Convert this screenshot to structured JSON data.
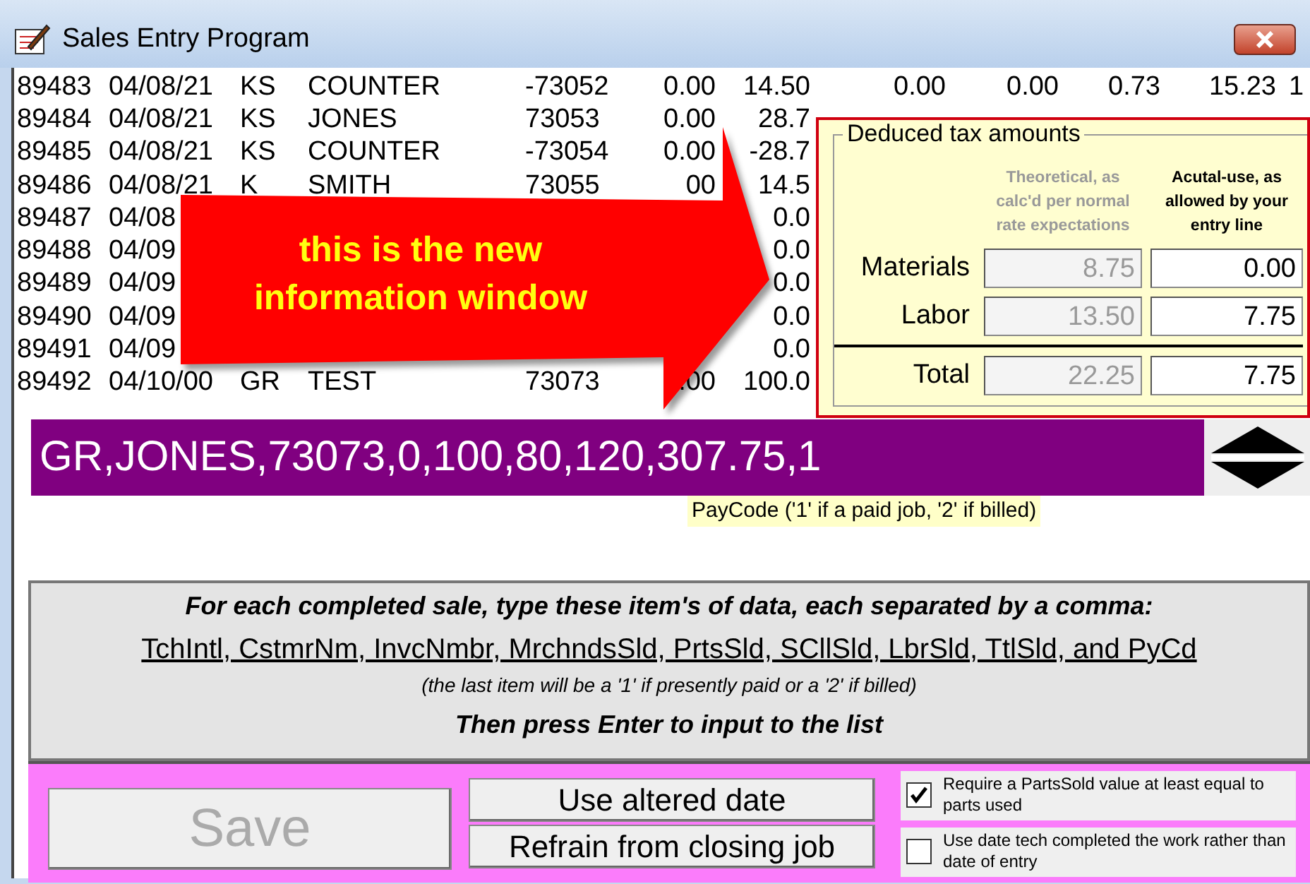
{
  "window": {
    "title": "Sales Entry Program"
  },
  "list": {
    "rows": [
      {
        "number": "89483",
        "date": "04/08/21",
        "tech": "KS",
        "customer": "COUNTER",
        "invoice": "-73052",
        "column_6": "0.00",
        "column_7": "14.50",
        "column_8": "0.00",
        "column_9": "0.00",
        "column_10": "0.73",
        "column_11": "15.23",
        "column_12": "1"
      },
      {
        "number": "89484",
        "date": "04/08/21",
        "tech": "KS",
        "customer": "JONES",
        "invoice": "73053",
        "column_6": "0.00",
        "column_7": "28.7"
      },
      {
        "number": "89485",
        "date": "04/08/21",
        "tech": "KS",
        "customer": "COUNTER",
        "invoice": "-73054",
        "column_6": "0.00",
        "column_7": "-28.7"
      },
      {
        "number": "89486",
        "date": "04/08/21",
        "tech": "K",
        "customer": "SMITH",
        "invoice": "73055",
        "column_6": "00",
        "column_7": "14.5"
      },
      {
        "number": "89487",
        "date": "04/08",
        "column_7": "0.0"
      },
      {
        "number": "89488",
        "date": "04/09",
        "column_7": "0.0"
      },
      {
        "number": "89489",
        "date": "04/09",
        "column_7": "0.0"
      },
      {
        "number": "89490",
        "date": "04/09",
        "column_7": "0.0"
      },
      {
        "number": "89491",
        "date": "04/09",
        "column_7": "0.0"
      },
      {
        "number": "89492",
        "date": "04/10/00",
        "tech": "GR",
        "customer": "TEST",
        "invoice": "73073",
        "column_6": ".00",
        "column_7": "100.0"
      }
    ]
  },
  "callout": {
    "text": "this is the new information window"
  },
  "tax_panel": {
    "title": "Deduced tax amounts",
    "columns": [
      {
        "label": "Theoretical, as calc'd per normal rate expectations",
        "disabled": true
      },
      {
        "label": "Acutal-use, as allowed by your entry line",
        "disabled": false
      }
    ],
    "rows": [
      {
        "kind": "line",
        "label": "Materials",
        "values": [
          "8.75",
          "0.00"
        ]
      },
      {
        "kind": "line",
        "label": "Labor",
        "values": [
          "13.50",
          "7.75"
        ]
      },
      {
        "kind": "total",
        "label": "Total",
        "values": [
          "22.25",
          "7.75"
        ]
      }
    ]
  },
  "entry": {
    "value": "GR,JONES,73073,0,100,80,120,307.75,1",
    "tooltip": "PayCode ('1' if a paid job, '2' if billed)"
  },
  "instructions": {
    "heading": "For each completed sale, type these item's of data, each separated by a comma:",
    "fields": "TchIntl, CstmrNm, InvcNmbr, MrchndsSld, PrtsSld, SCllSld, LbrSld, TtlSld, and PyCd",
    "note": "(the last item will be a '1' if presently paid or a '2' if billed)",
    "footer": "Then press Enter to input to the list"
  },
  "buttons": [
    {
      "kind": "large",
      "label": "Save",
      "disabled": true
    },
    {
      "kind": "small",
      "label": "Use altered date",
      "disabled": false
    },
    {
      "kind": "small",
      "label": "Refrain from closing job",
      "disabled": false
    }
  ],
  "options": [
    {
      "label": "Require a PartsSold value at least equal to parts used",
      "checked": true
    },
    {
      "label": "Use date tech completed the work rather than date of entry",
      "checked": false
    }
  ]
}
